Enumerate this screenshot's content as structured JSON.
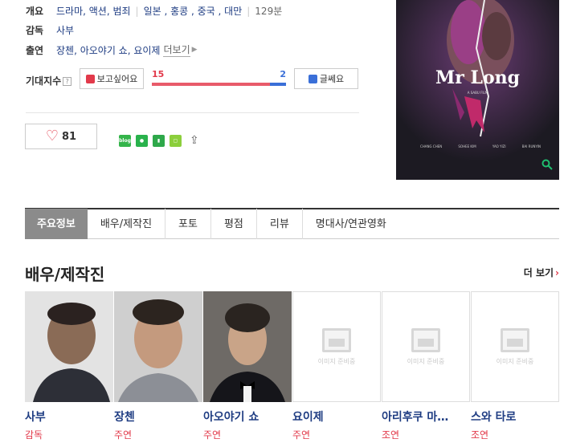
{
  "info": {
    "overview_label": "개요",
    "genres": "드라마, 액션, 범죄",
    "countries": "일본 , 홍콩 , 중국 , 대만",
    "runtime": "129분",
    "director_label": "감독",
    "director": "사부",
    "cast_label": "출연",
    "cast": "장첸, 아오야기 쇼, 요이제",
    "cast_more": "더보기"
  },
  "expectation": {
    "label": "기대지수",
    "help": "?",
    "want_label": "보고싶어요",
    "meh_label": "글쎄요",
    "want_count": "15",
    "meh_count": "2",
    "want_ratio": 0.88
  },
  "likes": {
    "count": "81"
  },
  "share": {
    "icons": [
      "blog-icon",
      "talk-icon",
      "bookmark-icon",
      "memo-icon",
      "share-out-icon"
    ],
    "blog_text": "blog"
  },
  "poster": {
    "title": "Mr Long",
    "subtitle": "A SABU FILM",
    "credits": [
      "CHANG CHEN",
      "SOHEE KIM",
      "YAO YIZI",
      "BAI RUNYIN"
    ]
  },
  "tabs": [
    "주요정보",
    "배우/제작진",
    "포토",
    "평점",
    "리뷰",
    "명대사/연관영화"
  ],
  "active_tab": 0,
  "crew_section": {
    "title": "배우/제작진",
    "more": "더 보기",
    "people": [
      {
        "name": "사부",
        "role": "감독",
        "photo": true
      },
      {
        "name": "장첸",
        "role": "주연",
        "photo": true
      },
      {
        "name": "아오야기 쇼",
        "role": "주연",
        "photo": true
      },
      {
        "name": "요이제",
        "role": "주연",
        "photo": false
      },
      {
        "name": "아리후쿠 마…",
        "role": "조연",
        "photo": false
      },
      {
        "name": "스와 타로",
        "role": "조연",
        "photo": false
      }
    ],
    "placeholder_text": "이미지 준비중"
  },
  "colors": {
    "link": "#1e3c82",
    "accent_red": "#e23a4b",
    "accent_blue": "#3a6fd8",
    "tab_active": "#8b8b8b"
  }
}
